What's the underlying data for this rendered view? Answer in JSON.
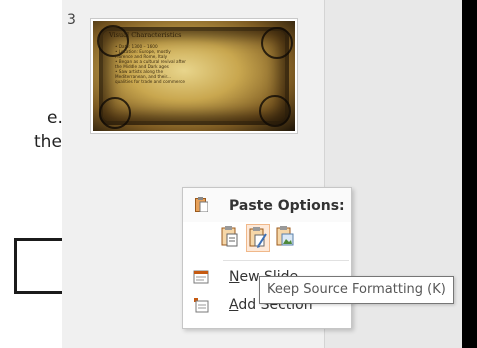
{
  "document": {
    "line1": "e.",
    "line2": "the"
  },
  "slide_pane": {
    "slide_number": "3",
    "thumbnail": {
      "title": "Visual Characteristics",
      "bullets": [
        "• Date: 1300 – 1600",
        "• Location: Europe, mostly",
        "  Florence and Rome, Italy",
        "• Began as a cultural revival after",
        "  the Middle and Dark ages",
        "• Saw artists along the",
        "  Mediterranean, and their...",
        "  qualities for trade and commerce"
      ]
    }
  },
  "context_menu": {
    "paste_options_label": "Paste Options:",
    "paste_buttons": [
      {
        "name": "use-destination-theme",
        "icon": "paste-destination-icon"
      },
      {
        "name": "keep-source-formatting",
        "icon": "paste-keep-source-icon",
        "selected": true
      },
      {
        "name": "picture",
        "icon": "paste-picture-icon"
      }
    ],
    "items": [
      {
        "prefix": "",
        "mnemonic": "N",
        "suffix": "ew Slide",
        "icon": "new-slide-icon"
      },
      {
        "prefix": "",
        "mnemonic": "A",
        "suffix": "dd Section",
        "icon": "add-section-icon"
      }
    ]
  },
  "tooltip": {
    "text": "Keep Source Formatting (K)"
  },
  "colors": {
    "hover_fill": "#fde9d9",
    "hover_border": "#f0b88a",
    "icon_accent": "#c55a11"
  }
}
